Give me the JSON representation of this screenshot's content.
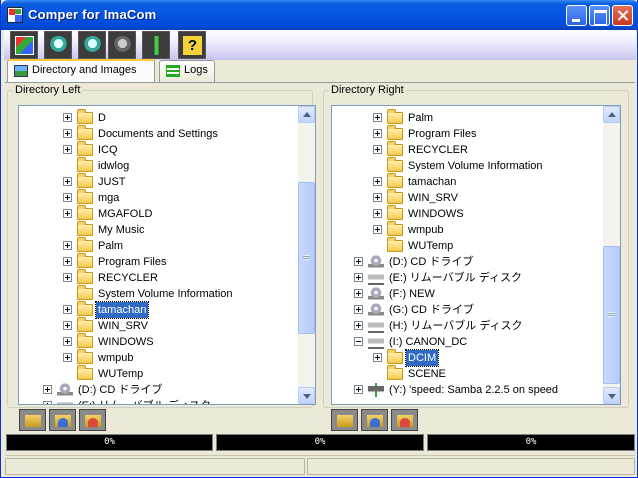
{
  "window": {
    "title": "Comper for ImaCom"
  },
  "toolbar": {
    "buttons": [
      "slideshow-icon",
      "search-icon",
      "search-alt-icon",
      "search-gray-icon",
      "tool-icon",
      "help-icon"
    ],
    "help_glyph": "?"
  },
  "tabs": [
    {
      "label": "Directory and Images",
      "active": true
    },
    {
      "label": "Logs",
      "active": false
    }
  ],
  "left": {
    "title": "Directory Left",
    "items": [
      {
        "label": "D",
        "expander": "plus",
        "type": "folder"
      },
      {
        "label": "Documents and Settings",
        "expander": "plus",
        "type": "folder"
      },
      {
        "label": "ICQ",
        "expander": "plus",
        "type": "folder"
      },
      {
        "label": "idwlog",
        "expander": "none",
        "type": "folder"
      },
      {
        "label": "JUST",
        "expander": "plus",
        "type": "folder"
      },
      {
        "label": "mga",
        "expander": "plus",
        "type": "folder"
      },
      {
        "label": "MGAFOLD",
        "expander": "plus",
        "type": "folder"
      },
      {
        "label": "My Music",
        "expander": "none",
        "type": "folder"
      },
      {
        "label": "Palm",
        "expander": "plus",
        "type": "folder"
      },
      {
        "label": "Program Files",
        "expander": "plus",
        "type": "folder"
      },
      {
        "label": "RECYCLER",
        "expander": "plus",
        "type": "folder"
      },
      {
        "label": "System Volume Information",
        "expander": "none",
        "type": "folder"
      },
      {
        "label": "tamachan",
        "expander": "plus",
        "type": "folder",
        "selected": true
      },
      {
        "label": "WIN_SRV",
        "expander": "plus",
        "type": "folder"
      },
      {
        "label": "WINDOWS",
        "expander": "plus",
        "type": "folder"
      },
      {
        "label": "wmpub",
        "expander": "plus",
        "type": "folder"
      },
      {
        "label": "WUTemp",
        "expander": "none",
        "type": "folder"
      },
      {
        "label": "(D:)  CD ドライブ",
        "expander": "plus",
        "type": "cd",
        "level": 0
      },
      {
        "label": "(E:)  リムーバブル ディスク",
        "expander": "plus",
        "type": "rem",
        "level": 0
      }
    ]
  },
  "right": {
    "title": "Directory Right",
    "items": [
      {
        "label": "Palm",
        "expander": "plus",
        "type": "folder"
      },
      {
        "label": "Program Files",
        "expander": "plus",
        "type": "folder"
      },
      {
        "label": "RECYCLER",
        "expander": "plus",
        "type": "folder"
      },
      {
        "label": "System Volume Information",
        "expander": "none",
        "type": "folder"
      },
      {
        "label": "tamachan",
        "expander": "plus",
        "type": "folder"
      },
      {
        "label": "WIN_SRV",
        "expander": "plus",
        "type": "folder"
      },
      {
        "label": "WINDOWS",
        "expander": "plus",
        "type": "folder"
      },
      {
        "label": "wmpub",
        "expander": "plus",
        "type": "folder"
      },
      {
        "label": "WUTemp",
        "expander": "none",
        "type": "folder"
      },
      {
        "label": "(D:)  CD ドライブ",
        "expander": "plus",
        "type": "cd",
        "level": 0
      },
      {
        "label": "(E:)  リムーバブル ディスク",
        "expander": "plus",
        "type": "rem",
        "level": 0
      },
      {
        "label": "(F:)  NEW",
        "expander": "plus",
        "type": "cd",
        "level": 0
      },
      {
        "label": "(G:)  CD ドライブ",
        "expander": "plus",
        "type": "cd",
        "level": 0
      },
      {
        "label": "(H:)  リムーバブル ディスク",
        "expander": "plus",
        "type": "rem",
        "level": 0
      },
      {
        "label": "(I:)  CANON_DC",
        "expander": "minus",
        "type": "rem",
        "level": 0
      },
      {
        "label": "DCIM",
        "expander": "plus",
        "type": "folder",
        "selected": true
      },
      {
        "label": "SCENE",
        "expander": "none",
        "type": "folder"
      },
      {
        "label": "(Y:)  'speed: Samba 2.2.5 on speed",
        "expander": "plus",
        "type": "net",
        "level": 0
      }
    ]
  },
  "progress": [
    {
      "label": "0%",
      "value": 0
    },
    {
      "label": "0%",
      "value": 0
    },
    {
      "label": "0%",
      "value": 0
    }
  ],
  "status": [
    "",
    ""
  ]
}
